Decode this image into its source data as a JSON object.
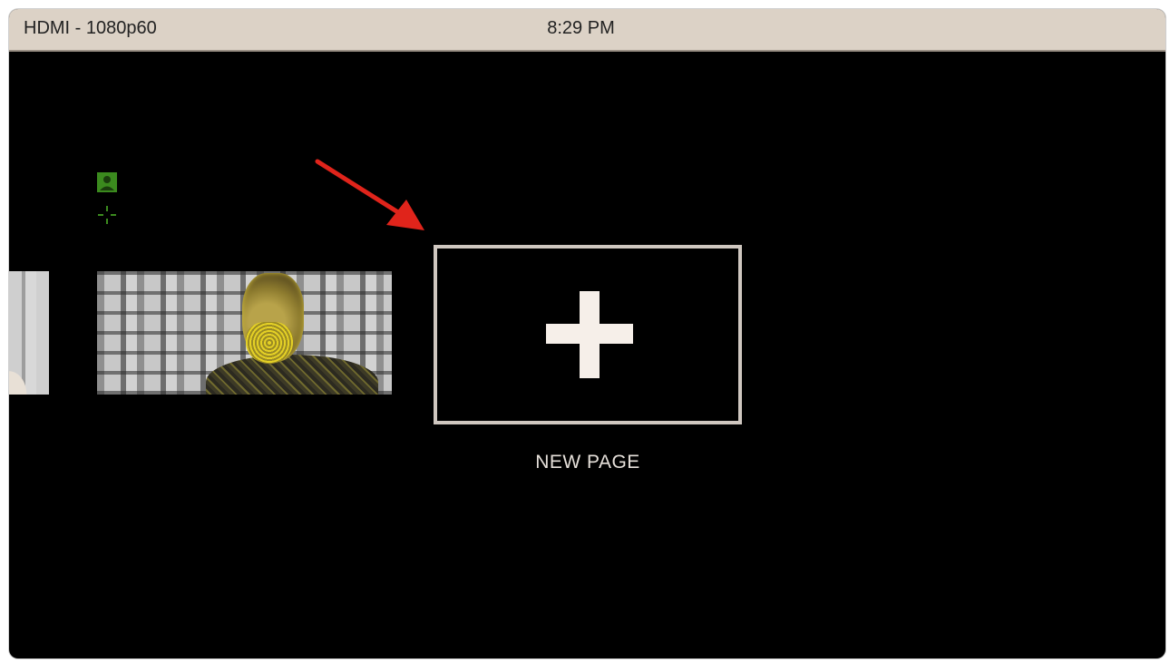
{
  "status_bar": {
    "source": "HDMI - 1080p60",
    "time": "8:29 PM"
  },
  "pages": {
    "new_page_label": "NEW PAGE",
    "new_page_icon": "plus-icon"
  },
  "overlay_icons": [
    "person-icon",
    "crosshair-icon",
    "red-arrow"
  ],
  "colors": {
    "status_bar": "#dcd2c6",
    "background": "#000000",
    "tile_border": "#cfc7c0",
    "overlay_green": "#3b8a1e",
    "arrow": "#e0241b"
  }
}
